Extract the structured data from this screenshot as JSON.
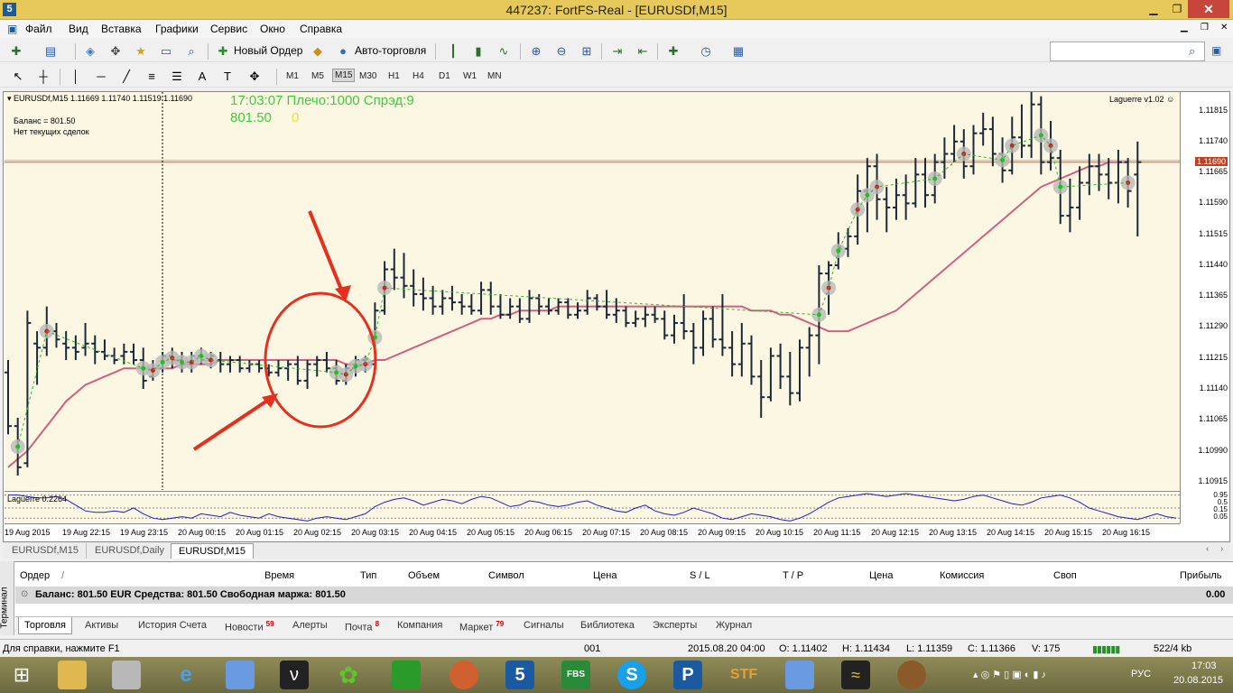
{
  "window": {
    "title": "447237: FortFS-Real - [EURUSDf,M15]",
    "icon": "metatrader-icon"
  },
  "menu": [
    "Файл",
    "Вид",
    "Вставка",
    "Графики",
    "Сервис",
    "Окно",
    "Справка"
  ],
  "toolbar": {
    "new_order": "Новый Ордер",
    "auto_trading": "Авто-торговля"
  },
  "timeframes": [
    "M1",
    "M5",
    "M15",
    "M30",
    "H1",
    "H4",
    "D1",
    "W1",
    "MN"
  ],
  "active_timeframe": "M15",
  "chart": {
    "header": "EURUSDf,M15  1.11669 1.11740 1.11519 1.11690",
    "info_line1": "17:03:07 Плечо:1000 Спрэд:9",
    "balance_value": "801.50",
    "zero_value": "0",
    "balance_label": "Баланс = 801.50",
    "no_trades": "Нет текущих сделок",
    "indicator_name": "Laguerre v1.02",
    "sub_indicator": "Laguerre 0.2264",
    "current_price": "1.11690",
    "colors": {
      "bg": "#fcf7e2",
      "info": "#3ccc3c",
      "ma": "#d06080",
      "osc": "#2020c0",
      "annot": "#e53020"
    }
  },
  "chart_data": {
    "type": "ohlc",
    "price_ticks": [
      "1.11815",
      "1.11740",
      "1.11665",
      "1.11590",
      "1.11515",
      "1.11440",
      "1.11365",
      "1.11290",
      "1.11215",
      "1.11140",
      "1.11065",
      "1.10990",
      "1.10915"
    ],
    "ylim": [
      1.10895,
      1.1186
    ],
    "time_ticks": [
      "19 Aug 2015",
      "19 Aug 22:15",
      "19 Aug 23:15",
      "20 Aug 00:15",
      "20 Aug 01:15",
      "20 Aug 02:15",
      "20 Aug 03:15",
      "20 Aug 04:15",
      "20 Aug 05:15",
      "20 Aug 06:15",
      "20 Aug 07:15",
      "20 Aug 08:15",
      "20 Aug 09:15",
      "20 Aug 10:15",
      "20 Aug 11:15",
      "20 Aug 12:15",
      "20 Aug 13:15",
      "20 Aug 14:15",
      "20 Aug 15:15",
      "20 Aug 16:15"
    ],
    "osc_ticks": [
      "0.95",
      "0.5",
      "0.15",
      "0.05"
    ],
    "ohlc": [
      [
        1.1118,
        1.1121,
        1.1103,
        1.1105
      ],
      [
        1.1105,
        1.1107,
        1.1093,
        1.1095
      ],
      [
        1.1096,
        1.1133,
        1.1095,
        1.113
      ],
      [
        1.1125,
        1.1128,
        1.1115,
        1.1124
      ],
      [
        1.1124,
        1.1134,
        1.1122,
        1.1128
      ],
      [
        1.1128,
        1.113,
        1.1124,
        1.1126
      ],
      [
        1.1125,
        1.1128,
        1.1121,
        1.1124
      ],
      [
        1.1124,
        1.1127,
        1.1121,
        1.1123
      ],
      [
        1.1124,
        1.113,
        1.1122,
        1.1125
      ],
      [
        1.1125,
        1.1127,
        1.112,
        1.1123
      ],
      [
        1.1123,
        1.1126,
        1.1121,
        1.1122
      ],
      [
        1.1122,
        1.1124,
        1.112,
        1.1121
      ],
      [
        1.1122,
        1.1125,
        1.112,
        1.1123
      ],
      [
        1.1123,
        1.1125,
        1.112,
        1.1121
      ],
      [
        1.1121,
        1.1124,
        1.1114,
        1.1116
      ],
      [
        1.1117,
        1.1121,
        1.1116,
        1.1119
      ],
      [
        1.1119,
        1.1123,
        1.1118,
        1.1122
      ],
      [
        1.1122,
        1.1124,
        1.1119,
        1.1121
      ],
      [
        1.1121,
        1.1123,
        1.1118,
        1.112
      ],
      [
        1.112,
        1.1123,
        1.1118,
        1.1122
      ],
      [
        1.1122,
        1.1124,
        1.112,
        1.1121
      ],
      [
        1.1121,
        1.1123,
        1.1119,
        1.1122
      ],
      [
        1.1121,
        1.1123,
        1.1118,
        1.112
      ],
      [
        1.112,
        1.1122,
        1.1118,
        1.1121
      ],
      [
        1.1121,
        1.1122,
        1.1118,
        1.1119
      ],
      [
        1.1119,
        1.1121,
        1.1118,
        1.112
      ],
      [
        1.112,
        1.1121,
        1.1118,
        1.1119
      ],
      [
        1.1119,
        1.112,
        1.1117,
        1.1118
      ],
      [
        1.1118,
        1.1121,
        1.1117,
        1.1119
      ],
      [
        1.1119,
        1.1121,
        1.1116,
        1.112
      ],
      [
        1.112,
        1.1122,
        1.1115,
        1.1116
      ],
      [
        1.1116,
        1.1121,
        1.1114,
        1.112
      ],
      [
        1.112,
        1.1122,
        1.1117,
        1.1121
      ],
      [
        1.1121,
        1.1123,
        1.1118,
        1.1119
      ],
      [
        1.1119,
        1.1121,
        1.1115,
        1.1116
      ],
      [
        1.1116,
        1.112,
        1.1115,
        1.1119
      ],
      [
        1.1119,
        1.1122,
        1.1117,
        1.1121
      ],
      [
        1.1121,
        1.1122,
        1.1118,
        1.112
      ],
      [
        1.112,
        1.1135,
        1.1118,
        1.1133
      ],
      [
        1.1133,
        1.1145,
        1.1132,
        1.1143
      ],
      [
        1.1143,
        1.1148,
        1.1138,
        1.1141
      ],
      [
        1.1141,
        1.1147,
        1.1136,
        1.1139
      ],
      [
        1.1139,
        1.1143,
        1.1134,
        1.1137
      ],
      [
        1.1137,
        1.1141,
        1.1133,
        1.1136
      ],
      [
        1.1136,
        1.1139,
        1.1132,
        1.1134
      ],
      [
        1.1134,
        1.1138,
        1.1132,
        1.1136
      ],
      [
        1.1136,
        1.1139,
        1.1133,
        1.1135
      ],
      [
        1.1135,
        1.1137,
        1.1132,
        1.1134
      ],
      [
        1.1134,
        1.1137,
        1.1132,
        1.1133
      ],
      [
        1.1133,
        1.114,
        1.1132,
        1.1138
      ],
      [
        1.1138,
        1.114,
        1.1132,
        1.1134
      ],
      [
        1.1134,
        1.1137,
        1.1131,
        1.1132
      ],
      [
        1.1132,
        1.1136,
        1.1131,
        1.1134
      ],
      [
        1.1134,
        1.1136,
        1.113,
        1.1131
      ],
      [
        1.1131,
        1.1138,
        1.113,
        1.1136
      ],
      [
        1.1136,
        1.1137,
        1.1132,
        1.1134
      ],
      [
        1.1134,
        1.1136,
        1.1132,
        1.1133
      ],
      [
        1.1133,
        1.1136,
        1.1132,
        1.1135
      ],
      [
        1.1135,
        1.1136,
        1.1131,
        1.1132
      ],
      [
        1.1132,
        1.1135,
        1.1131,
        1.1133
      ],
      [
        1.1133,
        1.1138,
        1.1132,
        1.1136
      ],
      [
        1.1136,
        1.1137,
        1.1133,
        1.1134
      ],
      [
        1.1134,
        1.1138,
        1.1131,
        1.1132
      ],
      [
        1.1132,
        1.1136,
        1.113,
        1.1133
      ],
      [
        1.1133,
        1.1134,
        1.1129,
        1.113
      ],
      [
        1.113,
        1.1133,
        1.1129,
        1.1131
      ],
      [
        1.1131,
        1.1134,
        1.1129,
        1.1132
      ],
      [
        1.1132,
        1.1134,
        1.113,
        1.1131
      ],
      [
        1.1131,
        1.1133,
        1.1126,
        1.1127
      ],
      [
        1.1127,
        1.1132,
        1.1125,
        1.113
      ],
      [
        1.113,
        1.1137,
        1.1126,
        1.1128
      ],
      [
        1.1128,
        1.113,
        1.112,
        1.1124
      ],
      [
        1.1124,
        1.1133,
        1.1122,
        1.1131
      ],
      [
        1.1131,
        1.1134,
        1.1124,
        1.1126
      ],
      [
        1.1126,
        1.1137,
        1.1122,
        1.1124
      ],
      [
        1.1124,
        1.1128,
        1.1117,
        1.112
      ],
      [
        1.112,
        1.113,
        1.1117,
        1.1125
      ],
      [
        1.1125,
        1.1127,
        1.1115,
        1.1117
      ],
      [
        1.1117,
        1.1121,
        1.1107,
        1.1112
      ],
      [
        1.1112,
        1.1124,
        1.1111,
        1.1122
      ],
      [
        1.1122,
        1.1125,
        1.1114,
        1.1117
      ],
      [
        1.1117,
        1.1123,
        1.111,
        1.1113
      ],
      [
        1.1113,
        1.1126,
        1.1111,
        1.1124
      ],
      [
        1.1124,
        1.1129,
        1.1117,
        1.1127
      ],
      [
        1.1127,
        1.1144,
        1.112,
        1.1142
      ],
      [
        1.1142,
        1.1145,
        1.1132,
        1.1144
      ],
      [
        1.1144,
        1.1152,
        1.1143,
        1.1148
      ],
      [
        1.1148,
        1.1153,
        1.1146,
        1.1151
      ],
      [
        1.1151,
        1.1166,
        1.1149,
        1.1162
      ],
      [
        1.1162,
        1.117,
        1.1152,
        1.1168
      ],
      [
        1.1168,
        1.1171,
        1.1155,
        1.116
      ],
      [
        1.116,
        1.1163,
        1.1152,
        1.1158
      ],
      [
        1.1158,
        1.1165,
        1.1155,
        1.1161
      ],
      [
        1.1161,
        1.1166,
        1.1155,
        1.1159
      ],
      [
        1.1159,
        1.117,
        1.1158,
        1.1166
      ],
      [
        1.1166,
        1.117,
        1.1158,
        1.1161
      ],
      [
        1.1161,
        1.1171,
        1.1159,
        1.1169
      ],
      [
        1.1169,
        1.1175,
        1.1165,
        1.1171
      ],
      [
        1.1171,
        1.1178,
        1.1169,
        1.1174
      ],
      [
        1.1174,
        1.1177,
        1.1165,
        1.1168
      ],
      [
        1.1168,
        1.1178,
        1.1166,
        1.1176
      ],
      [
        1.1176,
        1.1181,
        1.1173,
        1.1177
      ],
      [
        1.1177,
        1.118,
        1.1168,
        1.1171
      ],
      [
        1.1171,
        1.1175,
        1.1164,
        1.1167
      ],
      [
        1.1167,
        1.118,
        1.1166,
        1.1175
      ],
      [
        1.1175,
        1.1183,
        1.117,
        1.1173
      ],
      [
        1.1173,
        1.1186,
        1.117,
        1.1183
      ],
      [
        1.1183,
        1.1185,
        1.1166,
        1.1169
      ],
      [
        1.1169,
        1.1179,
        1.1167,
        1.117
      ],
      [
        1.117,
        1.1172,
        1.1154,
        1.1156
      ],
      [
        1.1156,
        1.1165,
        1.1152,
        1.1158
      ],
      [
        1.1158,
        1.1168,
        1.1155,
        1.1164
      ],
      [
        1.1164,
        1.1171,
        1.1161,
        1.1168
      ],
      [
        1.1168,
        1.1171,
        1.1162,
        1.1166
      ],
      [
        1.1166,
        1.117,
        1.116,
        1.1164
      ],
      [
        1.1164,
        1.1172,
        1.1159,
        1.1169
      ],
      [
        1.1169,
        1.117,
        1.1158,
        1.1162
      ],
      [
        1.1166,
        1.1174,
        1.1151,
        1.1169
      ]
    ],
    "ma_color": "#d06080",
    "ma": [
      1.1095,
      1.1097,
      1.1099,
      1.1102,
      1.1105,
      1.1108,
      1.1111,
      1.1113,
      1.1115,
      1.1116,
      1.1117,
      1.1118,
      1.1119,
      1.1119,
      1.1119,
      1.1119,
      1.1119,
      1.1119,
      1.112,
      1.112,
      1.112,
      1.112,
      1.1121,
      1.1121,
      1.1121,
      1.1121,
      1.1121,
      1.1121,
      1.1121,
      1.1121,
      1.1121,
      1.1121,
      1.1121,
      1.1121,
      1.1121,
      1.112,
      1.112,
      1.112,
      1.1121,
      1.1121,
      1.1122,
      1.1123,
      1.1124,
      1.1125,
      1.1126,
      1.1127,
      1.1128,
      1.1129,
      1.113,
      1.1131,
      1.1131,
      1.1132,
      1.1132,
      1.1133,
      1.1133,
      1.1133,
      1.1133,
      1.1134,
      1.1134,
      1.1134,
      1.1134,
      1.1134,
      1.1134,
      1.1134,
      1.1134,
      1.1134,
      1.1134,
      1.1134,
      1.1134,
      1.1134,
      1.1134,
      1.1134,
      1.1134,
      1.1134,
      1.1134,
      1.1134,
      1.1134,
      1.1133,
      1.1133,
      1.1133,
      1.1132,
      1.1132,
      1.1131,
      1.113,
      1.1129,
      1.1128,
      1.1128,
      1.1128,
      1.1129,
      1.113,
      1.1131,
      1.1132,
      1.1133,
      1.1135,
      1.1137,
      1.1139,
      1.1141,
      1.1143,
      1.1145,
      1.1147,
      1.1149,
      1.1151,
      1.1153,
      1.1155,
      1.1157,
      1.1159,
      1.1161,
      1.1163,
      1.1164,
      1.1165,
      1.1166,
      1.1167,
      1.1168,
      1.1168,
      1.1169,
      1.1169,
      1.1169
    ],
    "osc": [
      0.95,
      0.95,
      0.9,
      0.85,
      0.85,
      0.9,
      0.8,
      0.6,
      0.4,
      0.35,
      0.35,
      0.4,
      0.35,
      0.5,
      0.3,
      0.15,
      0.1,
      0.15,
      0.2,
      0.15,
      0.3,
      0.25,
      0.2,
      0.35,
      0.25,
      0.2,
      0.15,
      0.3,
      0.2,
      0.15,
      0.1,
      0.05,
      0.15,
      0.2,
      0.15,
      0.1,
      0.2,
      0.3,
      0.55,
      0.7,
      0.8,
      0.85,
      0.75,
      0.6,
      0.7,
      0.8,
      0.75,
      0.65,
      0.8,
      0.9,
      0.85,
      0.7,
      0.55,
      0.6,
      0.75,
      0.7,
      0.6,
      0.55,
      0.6,
      0.7,
      0.75,
      0.6,
      0.5,
      0.4,
      0.35,
      0.5,
      0.6,
      0.4,
      0.3,
      0.25,
      0.35,
      0.5,
      0.4,
      0.3,
      0.15,
      0.1,
      0.2,
      0.3,
      0.25,
      0.2,
      0.1,
      0.05,
      0.15,
      0.3,
      0.5,
      0.7,
      0.85,
      0.9,
      0.95,
      1.0,
      0.95,
      0.9,
      0.95,
      1.0,
      0.95,
      0.9,
      0.85,
      0.8,
      0.75,
      0.8,
      0.9,
      0.95,
      0.85,
      0.75,
      0.65,
      0.6,
      0.7,
      0.85,
      0.9,
      0.95,
      0.85,
      0.7,
      0.5,
      0.4,
      0.3,
      0.2,
      0.15,
      0.1,
      0.2,
      0.3,
      0.2,
      0.15
    ],
    "vline_time": "19 Aug 23:45",
    "hline_price": 1.1169
  },
  "chart_tabs": [
    "EURUSDf,M15",
    "EURUSDf,Daily",
    "EURUSDf,M15"
  ],
  "terminal": {
    "side_label": "Терминал",
    "columns": [
      "Ордер",
      "Время",
      "Тип",
      "Объем",
      "Символ",
      "Цена",
      "S / L",
      "T / P",
      "Цена",
      "Комиссия",
      "Своп",
      "Прибыль"
    ],
    "balance_row": "Баланс: 801.50 EUR  Средства: 801.50  Свободная маржа: 801.50",
    "profit": "0.00",
    "tabs": [
      {
        "label": "Торговля",
        "badge": ""
      },
      {
        "label": "Активы",
        "badge": ""
      },
      {
        "label": "История Счета",
        "badge": ""
      },
      {
        "label": "Новости",
        "badge": "59"
      },
      {
        "label": "Алерты",
        "badge": ""
      },
      {
        "label": "Почта",
        "badge": "8"
      },
      {
        "label": "Компания",
        "badge": ""
      },
      {
        "label": "Маркет",
        "badge": "79"
      },
      {
        "label": "Сигналы",
        "badge": ""
      },
      {
        "label": "Библиотека",
        "badge": ""
      },
      {
        "label": "Эксперты",
        "badge": ""
      },
      {
        "label": "Журнал",
        "badge": ""
      }
    ]
  },
  "status": {
    "help": "Для справки, нажмите F1",
    "profile": "001",
    "datetime": "2015.08.20 04:00",
    "o": "O: 1.11402",
    "h": "H: 1.11434",
    "l": "L: 1.11359",
    "c": "C: 1.11366",
    "v": "V: 175",
    "traffic": "522/4 kb"
  },
  "taskbar": {
    "lang": "РУС",
    "time": "17:03",
    "date": "20.08.2015"
  }
}
